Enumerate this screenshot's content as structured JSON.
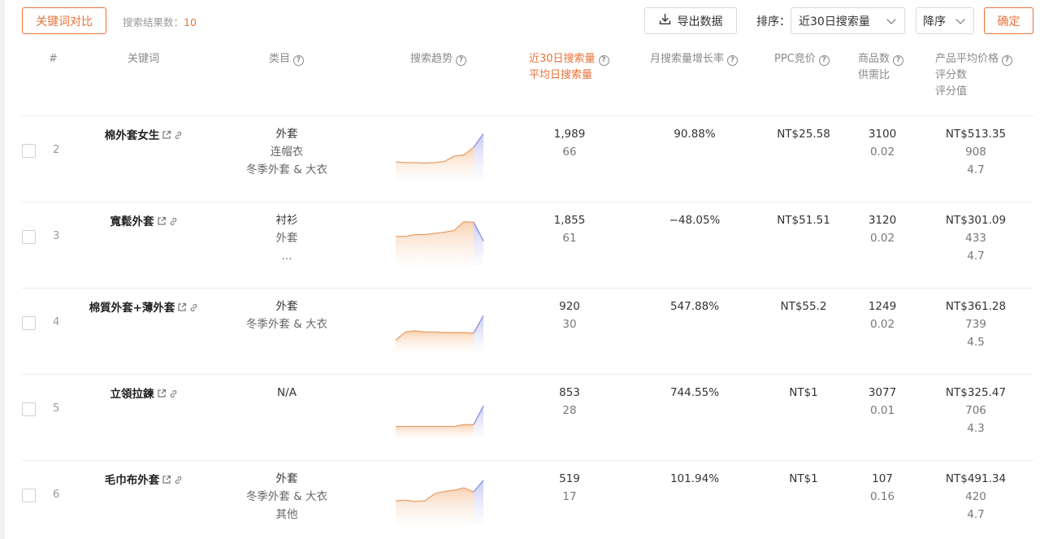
{
  "toolbar": {
    "compare_label": "关键词对比",
    "result_label": "搜索结果数：",
    "result_count": "10",
    "export_label": "导出数据",
    "sort_label": "排序：",
    "sort_value": "近30日搜索量",
    "order_value": "降序",
    "confirm_label": "确定"
  },
  "columns": {
    "index": "#",
    "keyword": "关键词",
    "category": "类目",
    "trend": "搜索趋势",
    "volume_line1": "近30日搜索量",
    "volume_line2": "平均日搜索量",
    "growth": "月搜索量增长率",
    "ppc": "PPC竞价",
    "goods_line1": "商品数",
    "goods_line2": "供需比",
    "price_line1": "产品平均价格",
    "price_line2": "评分数",
    "price_line3": "评分值"
  },
  "colors": {
    "accent": "#e8723a",
    "trend_line": "#e8a06a",
    "trend_recent": "#8a8fe0"
  },
  "rows": [
    {
      "index": "2",
      "keyword": "棉外套女生",
      "categories": [
        "外套",
        "连帽衣",
        "冬季外套 & 大衣"
      ],
      "trend": [
        30,
        29,
        29,
        28,
        29,
        31,
        40,
        42,
        55,
        78
      ],
      "volume": "1,989",
      "daily": "66",
      "growth": "90.88%",
      "ppc": "NT$25.58",
      "goods": "3100",
      "ratio": "0.02",
      "price": "NT$513.35",
      "ratings": "908",
      "score": "4.7"
    },
    {
      "index": "3",
      "keyword": "寬鬆外套",
      "categories": [
        "衬衫",
        "外套",
        "..."
      ],
      "trend": [
        50,
        50,
        53,
        53,
        55,
        57,
        60,
        75,
        74,
        42
      ],
      "volume": "1,855",
      "daily": "61",
      "growth": "−48.05%",
      "ppc": "NT$51.51",
      "goods": "3120",
      "ratio": "0.02",
      "price": "NT$301.09",
      "ratings": "433",
      "score": "4.7"
    },
    {
      "index": "4",
      "keyword": "棉質外套+薄外套",
      "categories": [
        "外套",
        "冬季外套 & 大衣"
      ],
      "trend": [
        20,
        34,
        36,
        34,
        34,
        33,
        33,
        33,
        32,
        62
      ],
      "volume": "920",
      "daily": "30",
      "growth": "547.88%",
      "ppc": "NT$55.2",
      "goods": "1249",
      "ratio": "0.02",
      "price": "NT$361.28",
      "ratings": "739",
      "score": "4.5"
    },
    {
      "index": "5",
      "keyword": "立領拉鍊",
      "categories": [
        "N/A"
      ],
      "trend": [
        20,
        20,
        20,
        20,
        20,
        20,
        20,
        23,
        23,
        55
      ],
      "volume": "853",
      "daily": "28",
      "growth": "744.55%",
      "ppc": "NT$1",
      "goods": "3077",
      "ratio": "0.01",
      "price": "NT$325.47",
      "ratings": "706",
      "score": "4.3"
    },
    {
      "index": "6",
      "keyword": "毛巾布外套",
      "categories": [
        "外套",
        "冬季外套 & 大衣",
        "其他"
      ],
      "trend": [
        40,
        41,
        39,
        40,
        52,
        56,
        58,
        62,
        55,
        75
      ],
      "volume": "519",
      "daily": "17",
      "growth": "101.94%",
      "ppc": "NT$1",
      "goods": "107",
      "ratio": "0.16",
      "price": "NT$491.34",
      "ratings": "420",
      "score": "4.7"
    }
  ]
}
